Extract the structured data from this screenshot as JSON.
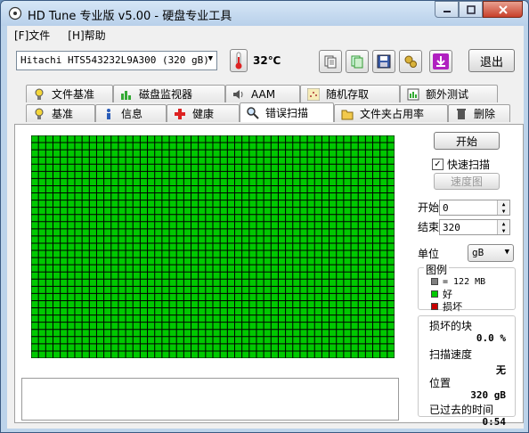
{
  "window": {
    "title": "HD Tune 专业版 v5.00 - 硬盘专业工具"
  },
  "menu": {
    "file": "[F]文件",
    "help": "[H]帮助"
  },
  "toolbar": {
    "drive": "Hitachi HTS543232L9A300 (320 gB)",
    "temperature": "32℃",
    "exit": "退出"
  },
  "tabs_top": [
    "文件基准",
    "磁盘监视器",
    "AAM",
    "随机存取",
    "额外测试"
  ],
  "tabs_bottom": [
    "基准",
    "信息",
    "健康",
    "错误扫描",
    "文件夹占用率",
    "删除"
  ],
  "active_tab": "错误扫描",
  "scan": {
    "start_button": "开始",
    "quick_scan_label": "快速扫描",
    "quick_scan_checked": true,
    "map_button": "速度图",
    "start_label": "开始",
    "start_value": "0",
    "end_label": "结束",
    "end_value": "320",
    "unit_label": "单位",
    "unit_value": "gB",
    "legend_title": "图例",
    "legend_block": "= 122 MB",
    "legend_good": "好",
    "legend_bad": "损坏",
    "damaged_label": "损坏的块",
    "damaged_value": "0.0 %",
    "speed_label": "扫描速度",
    "speed_value": "无",
    "position_label": "位置",
    "position_value": "320 gB",
    "elapsed_label": "已过去的时间",
    "elapsed_value": "0:54"
  },
  "colors": {
    "good": "#00c800",
    "bad": "#c80000",
    "block": "#808080",
    "grid_line": "#000000"
  }
}
